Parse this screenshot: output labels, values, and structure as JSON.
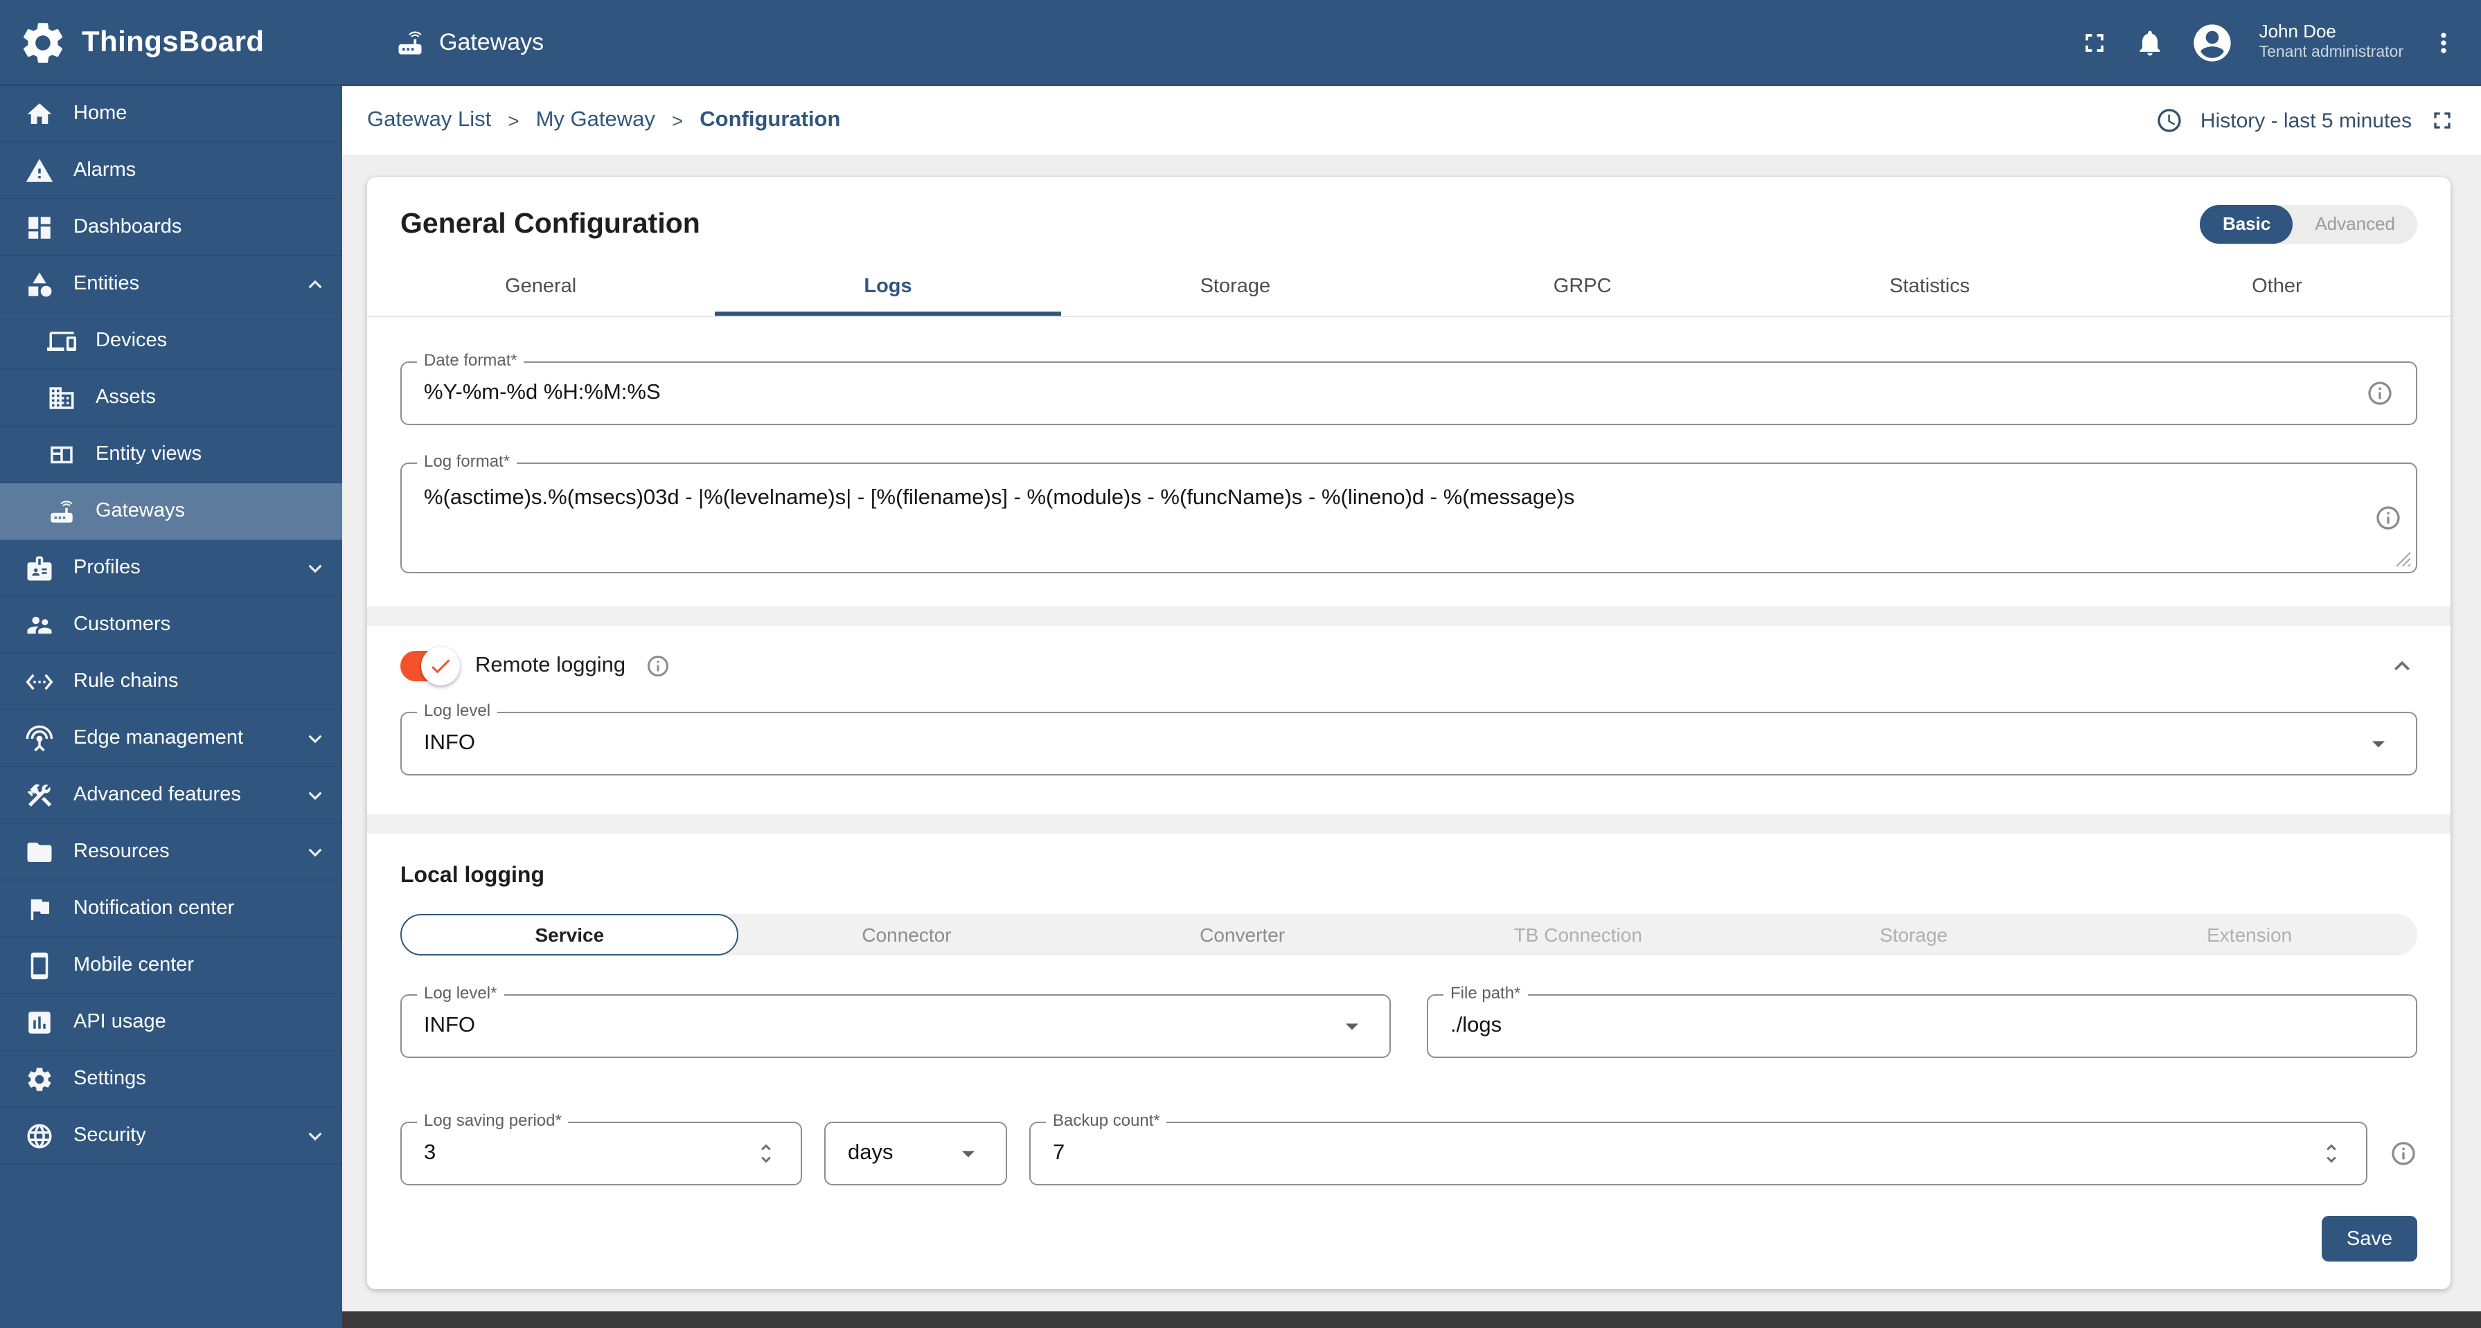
{
  "app": {
    "name": "ThingsBoard",
    "page_title": "Gateways"
  },
  "user": {
    "name": "John Doe",
    "role": "Tenant administrator"
  },
  "breadcrumb": {
    "items": [
      "Gateway List",
      "My Gateway",
      "Configuration"
    ],
    "separator": ">"
  },
  "toolbar": {
    "history_label": "History - last 5 minutes"
  },
  "sidebar": {
    "items": [
      {
        "label": "Home",
        "icon": "home-icon"
      },
      {
        "label": "Alarms",
        "icon": "warning-icon"
      },
      {
        "label": "Dashboards",
        "icon": "dashboards-icon"
      },
      {
        "label": "Entities",
        "icon": "category-icon",
        "expanded": true
      },
      {
        "label": "Devices",
        "icon": "devices-icon",
        "child": true
      },
      {
        "label": "Assets",
        "icon": "assets-icon",
        "child": true
      },
      {
        "label": "Entity views",
        "icon": "entity-views-icon",
        "child": true
      },
      {
        "label": "Gateways",
        "icon": "gateway-icon",
        "child": true,
        "selected": true
      },
      {
        "label": "Profiles",
        "icon": "profiles-icon",
        "collapsed": true
      },
      {
        "label": "Customers",
        "icon": "customers-icon"
      },
      {
        "label": "Rule chains",
        "icon": "rule-chains-icon"
      },
      {
        "label": "Edge management",
        "icon": "edge-management-icon",
        "collapsed": true
      },
      {
        "label": "Advanced features",
        "icon": "advanced-features-icon",
        "collapsed": true
      },
      {
        "label": "Resources",
        "icon": "resources-icon",
        "collapsed": true
      },
      {
        "label": "Notification center",
        "icon": "notification-center-icon"
      },
      {
        "label": "Mobile center",
        "icon": "mobile-center-icon"
      },
      {
        "label": "API usage",
        "icon": "api-usage-icon"
      },
      {
        "label": "Settings",
        "icon": "settings-icon"
      },
      {
        "label": "Security",
        "icon": "security-icon",
        "collapsed": true
      }
    ]
  },
  "config": {
    "title": "General Configuration",
    "mode": {
      "options": [
        "Basic",
        "Advanced"
      ],
      "selected": "Basic"
    },
    "tabs": [
      "General",
      "Logs",
      "Storage",
      "GRPC",
      "Statistics",
      "Other"
    ],
    "active_tab": "Logs",
    "date_format": {
      "label": "Date format*",
      "value": "%Y-%m-%d %H:%M:%S"
    },
    "log_format": {
      "label": "Log format*",
      "value": "%(asctime)s.%(msecs)03d - |%(levelname)s| - [%(filename)s] - %(module)s - %(funcName)s - %(lineno)d - %(message)s"
    },
    "remote_logging": {
      "label": "Remote logging",
      "enabled": true,
      "log_level": {
        "label": "Log level",
        "value": "INFO"
      }
    },
    "local_logging": {
      "title": "Local logging",
      "tabs": [
        "Service",
        "Connector",
        "Converter",
        "TB Connection",
        "Storage",
        "Extension"
      ],
      "active_tab": "Service",
      "log_level": {
        "label": "Log level*",
        "value": "INFO"
      },
      "file_path": {
        "label": "File path*",
        "value": "./logs"
      },
      "log_saving_period": {
        "label": "Log saving period*",
        "value": "3"
      },
      "period_unit": "days",
      "backup_count": {
        "label": "Backup count*",
        "value": "7"
      }
    },
    "save_label": "Save"
  }
}
